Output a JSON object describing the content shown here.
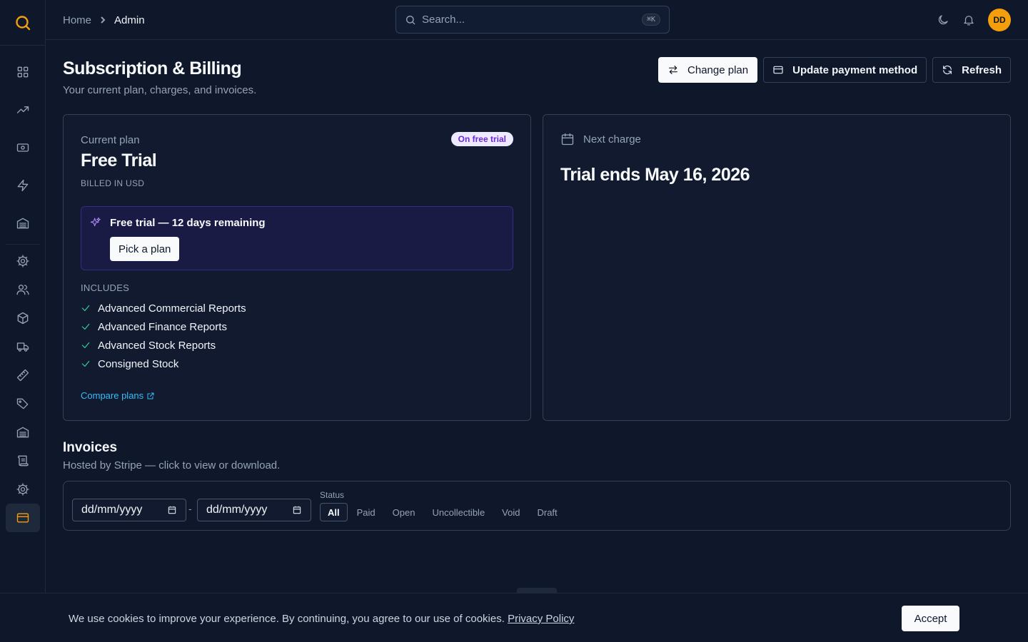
{
  "brand": {
    "logo_icon": "search-logo-icon",
    "accent": "#f59e0b"
  },
  "breadcrumb": {
    "home": "Home",
    "current": "Admin"
  },
  "search": {
    "placeholder": "Search...",
    "shortcut": "⌘K"
  },
  "user": {
    "initials": "DD"
  },
  "sidebar": {
    "items": [
      {
        "icon": "dashboard-icon"
      },
      {
        "icon": "trending-up-icon"
      },
      {
        "icon": "cash-icon"
      },
      {
        "icon": "lightning-icon"
      },
      {
        "icon": "warehouse-icon"
      },
      {
        "icon": "gear-icon"
      },
      {
        "icon": "users-icon"
      },
      {
        "icon": "box-icon"
      },
      {
        "icon": "truck-icon"
      },
      {
        "icon": "ruler-icon"
      },
      {
        "icon": "tag-icon"
      },
      {
        "icon": "warehouse-icon"
      },
      {
        "icon": "ledger-icon"
      },
      {
        "icon": "gear-icon"
      },
      {
        "icon": "credit-card-icon",
        "active": true
      }
    ]
  },
  "page": {
    "title": "Subscription & Billing",
    "subtitle": "Your current plan, charges, and invoices."
  },
  "actions": {
    "change_plan": "Change plan",
    "update_payment": "Update payment method",
    "refresh": "Refresh"
  },
  "plan": {
    "label": "Current plan",
    "badge": "On free trial",
    "name": "Free Trial",
    "billed": "BILLED IN USD",
    "trial_text": "Free trial — 12 days remaining",
    "pick_button": "Pick a plan",
    "includes_label": "INCLUDES",
    "features": [
      "Advanced Commercial Reports",
      "Advanced Finance Reports",
      "Advanced Stock Reports",
      "Consigned Stock"
    ],
    "compare_link": "Compare plans"
  },
  "charge": {
    "label": "Next charge",
    "value": "Trial ends May 16, 2026"
  },
  "invoices": {
    "title": "Invoices",
    "subtitle": "Hosted by Stripe — click to view or download.",
    "date_from_placeholder": "dd/mm/yyyy",
    "date_to_placeholder": "dd/mm/yyyy",
    "date_separator": "-",
    "status_label": "Status",
    "status_tabs": [
      "All",
      "Paid",
      "Open",
      "Uncollectible",
      "Void",
      "Draft"
    ],
    "active_status": "All"
  },
  "cookie": {
    "text": "We use cookies to improve your experience. By continuing, you agree to our use of cookies.",
    "link": "Privacy Policy",
    "accept": "Accept"
  }
}
